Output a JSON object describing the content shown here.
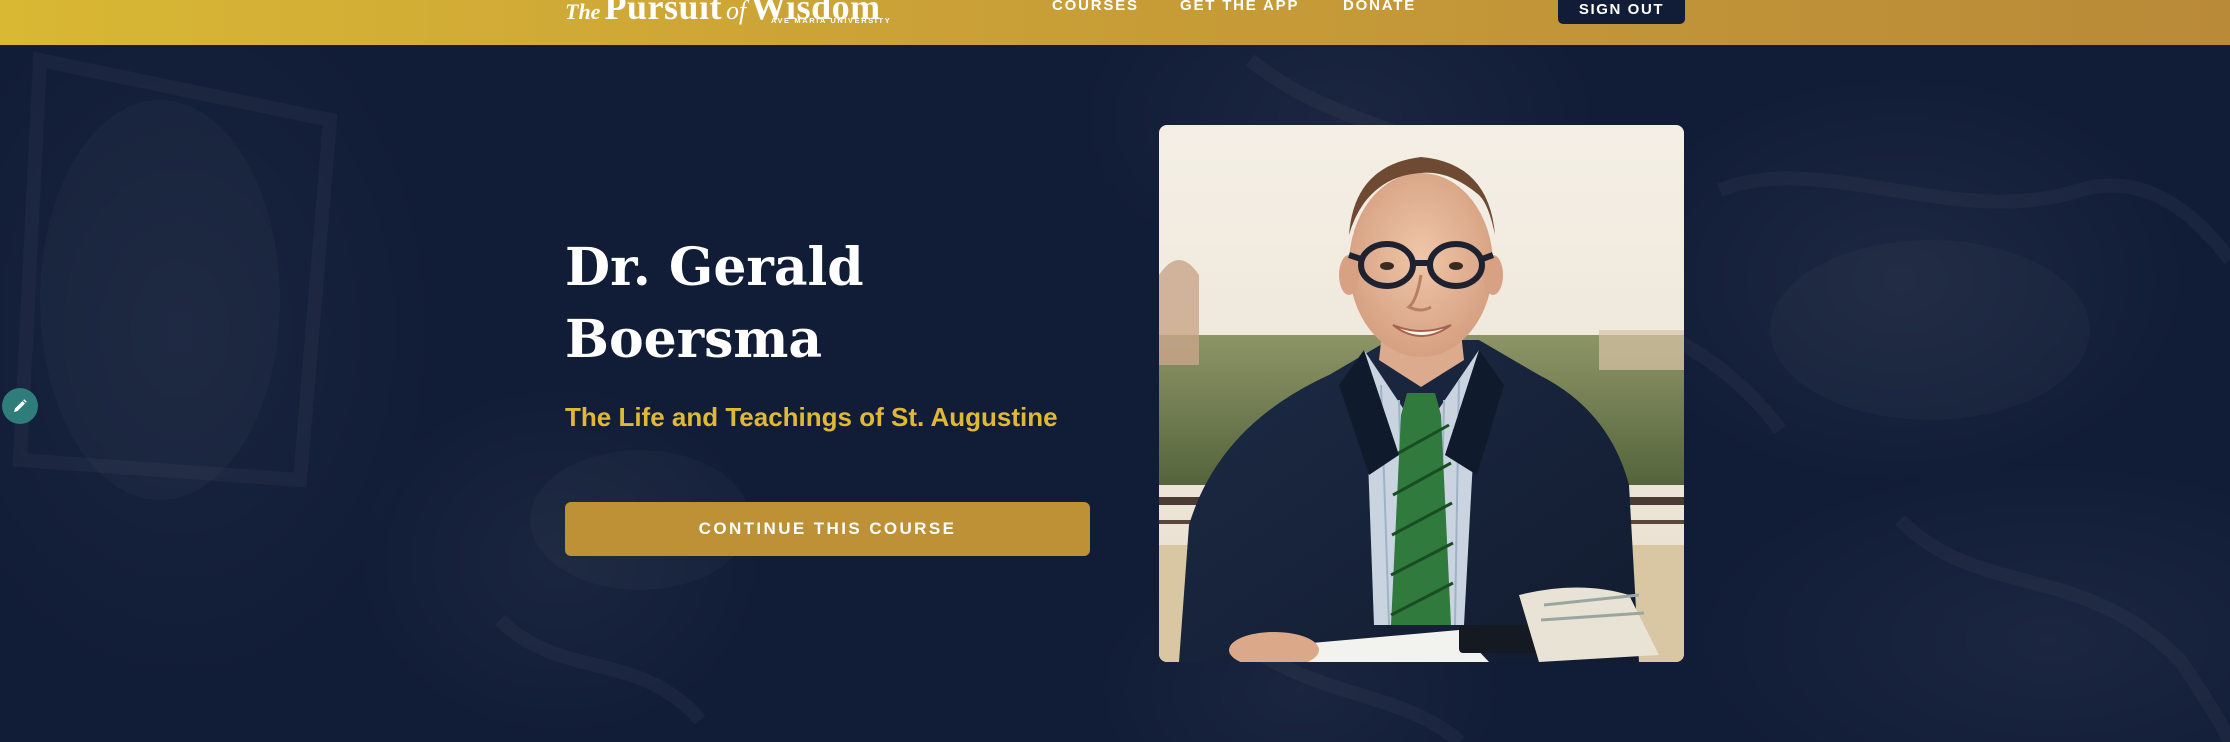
{
  "header": {
    "logo": {
      "the": "The",
      "pursuit": "Pursuit",
      "of": "of",
      "wisdom": "Wisdom",
      "subtitle": "AVE MARIA UNIVERSITY"
    },
    "nav": [
      {
        "label": "COURSES"
      },
      {
        "label": "GET THE APP"
      },
      {
        "label": "DONATE"
      }
    ],
    "sign_out_label": "SIGN OUT"
  },
  "hero": {
    "title_line1": "Dr. Gerald",
    "title_line2": "Boersma",
    "course_title": "The Life and Teachings of St. Augustine",
    "cta_label": "CONTINUE THIS COURSE"
  },
  "colors": {
    "header_gold_start": "#d9b834",
    "header_gold_end": "#b98a38",
    "navy_background": "#111c37",
    "subtitle_gold": "#e0b934",
    "button_gold": "#be9137",
    "edit_fab_teal": "#2f7d7a"
  },
  "icons": {
    "edit_fab": "pencil-icon"
  }
}
